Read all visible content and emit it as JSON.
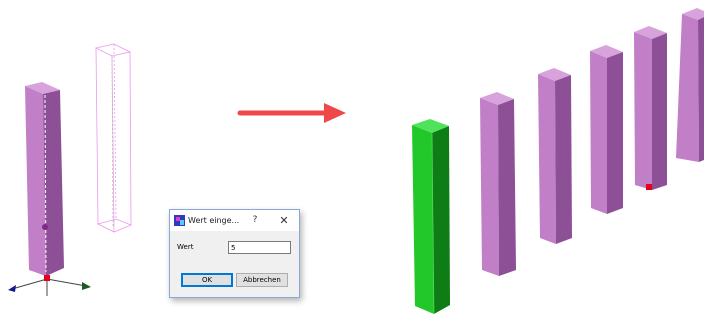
{
  "dialog": {
    "title": "Wert einge...",
    "help_label": "?",
    "close_label": "✕",
    "field_label": "Wert",
    "value": "5",
    "ok_label": "OK",
    "cancel_label": "Abbrechen"
  },
  "colors": {
    "column_purple_front": "#c07fc6",
    "column_purple_side": "#8d4f96",
    "column_purple_top": "#d8a2dc",
    "column_green_front": "#22c82a",
    "column_green_side": "#0e7d16",
    "column_green_top": "#4fe35a",
    "ghost_outline": "#e99aec",
    "arrow": "#ef4848",
    "axis_x": "#111a8c",
    "axis_y": "#1e5a20",
    "axis_z": "#7d2a8a",
    "origin_marker": "#e4001c"
  },
  "icons": {
    "arrow": "right-arrow",
    "app": "dialog-app-icon"
  },
  "scene": {
    "copies_count": 6
  }
}
